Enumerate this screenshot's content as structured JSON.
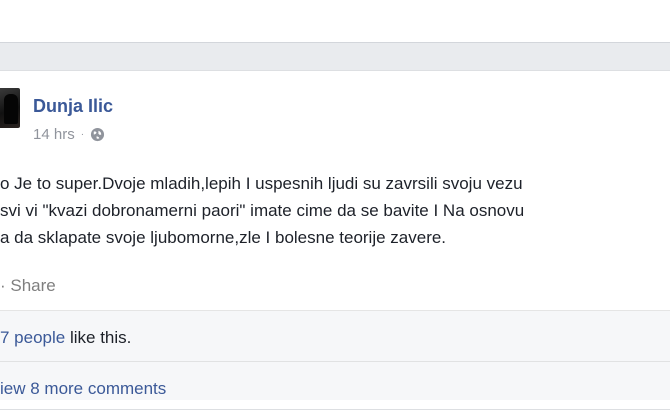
{
  "post": {
    "author": "Dunja Ilic",
    "timestamp": "14 hrs",
    "separator": "·",
    "privacy_icon": "globe-icon",
    "text_lines": [
      "o Je to super.Dvoje mladih,lepih I uspesnih ljudi su zavrsili svoju vezu",
      "svi vi \"kvazi dobronamerni paori\" imate cime da se bavite I Na osnovu",
      "a da sklapate svoje ljubomorne,zle I bolesne teorije zavere."
    ],
    "share_label": "· Share"
  },
  "likes": {
    "people_link": "7 people",
    "suffix": " like this."
  },
  "comments": {
    "view_more": "iew 8 more comments"
  },
  "colors": {
    "link": "#3b5998",
    "meta": "#90949c",
    "background": "#e9ebee"
  }
}
